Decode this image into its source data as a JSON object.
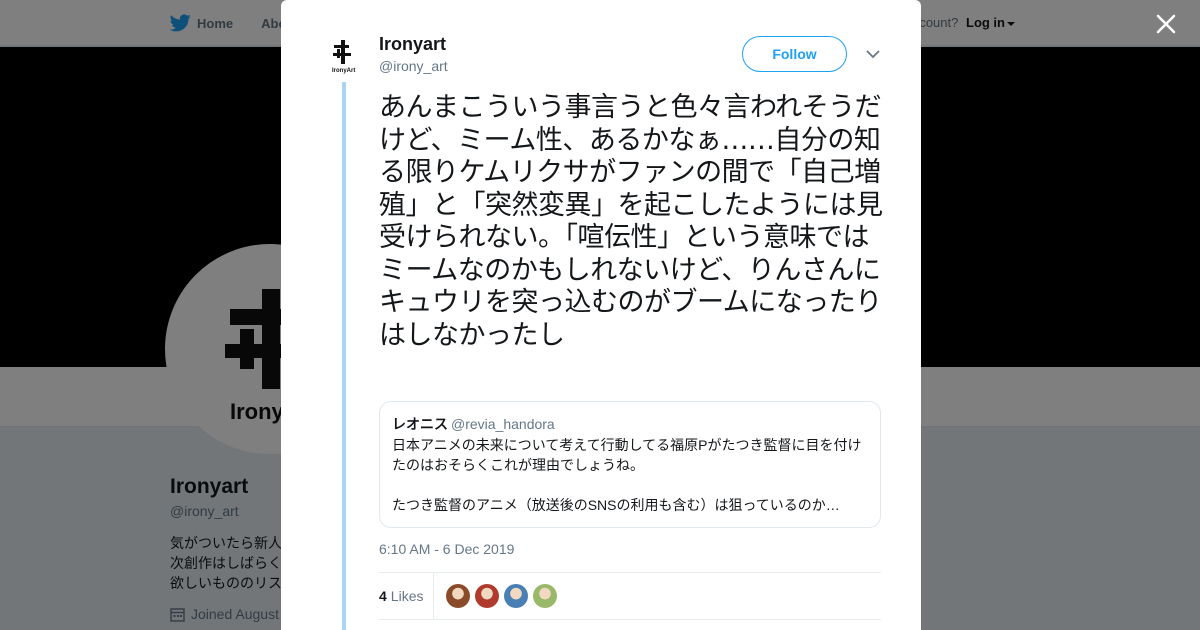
{
  "nav": {
    "home_label": "Home",
    "about_label": "Abo",
    "account_prompt": "ccount?",
    "login_label": "Log in"
  },
  "profile": {
    "name": "Ironyart",
    "handle": "@irony_art",
    "bio_lines": [
      "気がついたら新人",
      "次創作はしばらく",
      "欲しいもののリス"
    ],
    "joined": "Joined August"
  },
  "tweet": {
    "author_name": "Ironyart",
    "author_handle": "@irony_art",
    "avatar_label": "IronyArt",
    "follow_label": "Follow",
    "text": "あんまこういう事言うと色々言われそうだけど、ミーム性、あるかなぁ……自分の知る限りケムリクサがファンの間で「自己増殖」と「突然変異」を起こしたようには見受けられない。「喧伝性」という意味ではミームなのかもしれないけど、りんさんにキュウリを突っ込むのがブームになったりはしなかったし",
    "quote": {
      "name": "レオニス",
      "handle": "@revia_handora",
      "text": "日本アニメの未来について考えて行動してる福原Pがたつき監督に目を付けたのはおそらくこれが理由でしょうね。\n\nたつき監督のアニメ（放送後のSNSの利用も含む）は狙っているのか…"
    },
    "timestamp": "6:10 AM - 6 Dec 2019",
    "likes_count": "4",
    "likes_label": "Likes",
    "likers": [
      {
        "icon": "liker-avatar",
        "color": "#8a4b2b"
      },
      {
        "icon": "liker-avatar",
        "color": "#b03a2e"
      },
      {
        "icon": "liker-avatar",
        "color": "#4a7fb5"
      },
      {
        "icon": "liker-avatar",
        "color": "#9ab86a"
      }
    ]
  },
  "colors": {
    "accent": "#1da1f2",
    "thread_line": "#a9d5f3",
    "overlay": "rgba(0,0,0,0.5)"
  }
}
